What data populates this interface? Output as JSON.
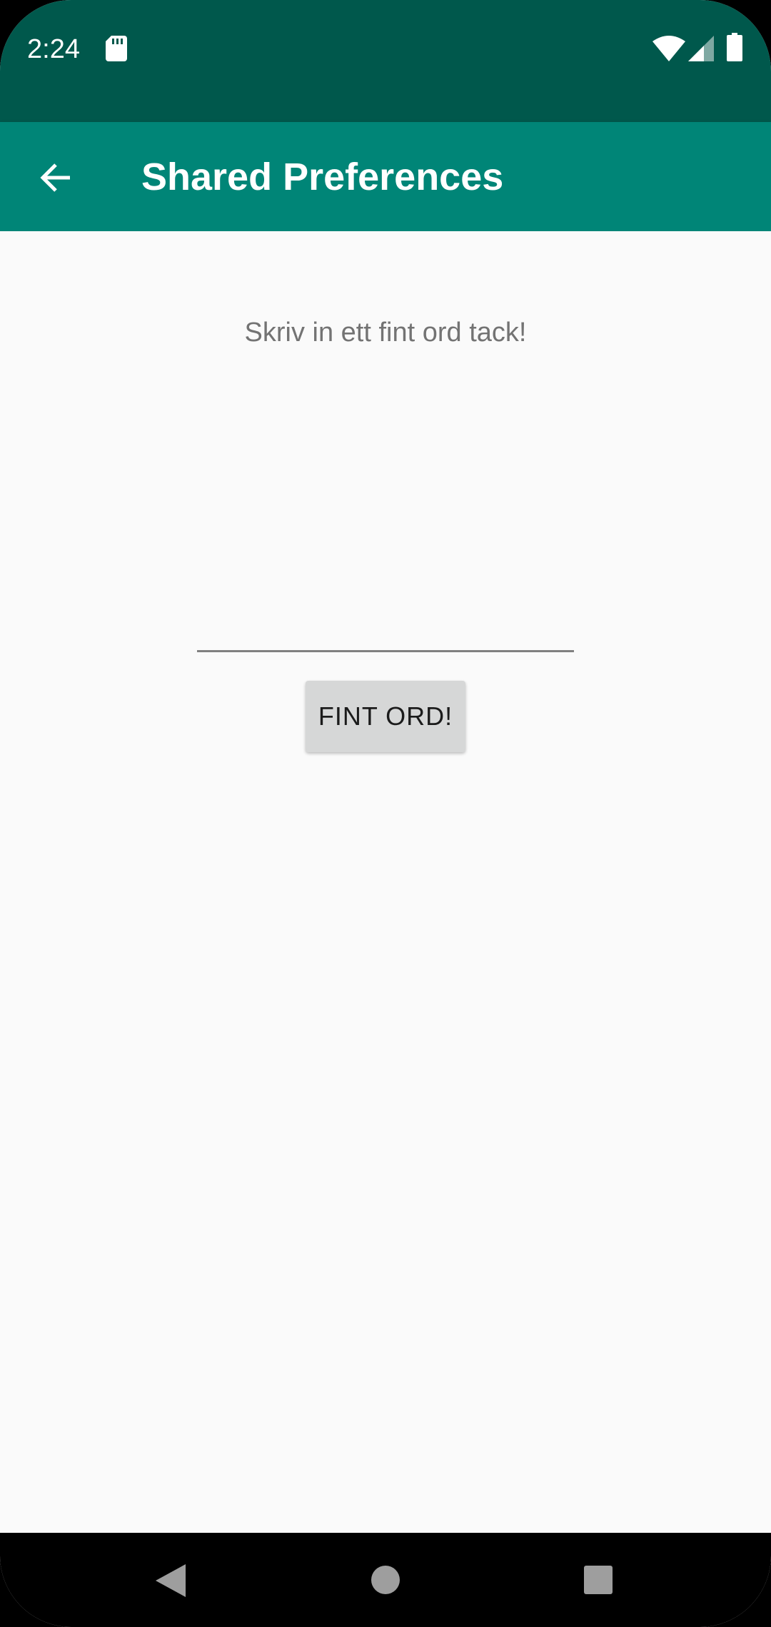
{
  "status_bar": {
    "time": "2:24",
    "icons": [
      "sd-card-icon",
      "wifi-icon",
      "cell-signal-icon",
      "battery-icon"
    ]
  },
  "app_bar": {
    "title": "Shared Preferences",
    "back_icon": "arrow-back-icon",
    "background_color": "#008577"
  },
  "main": {
    "prompt": "Skriv in ett fint ord tack!",
    "input": {
      "value": "",
      "placeholder": ""
    },
    "button_label": "FINT ORD!"
  },
  "nav_bar": {
    "icons": [
      "nav-back-icon",
      "nav-home-icon",
      "nav-recents-icon"
    ]
  },
  "colors": {
    "status_bar": "#00584c",
    "app_bar": "#008577",
    "background": "#fafafa",
    "button": "#d6d7d7"
  }
}
